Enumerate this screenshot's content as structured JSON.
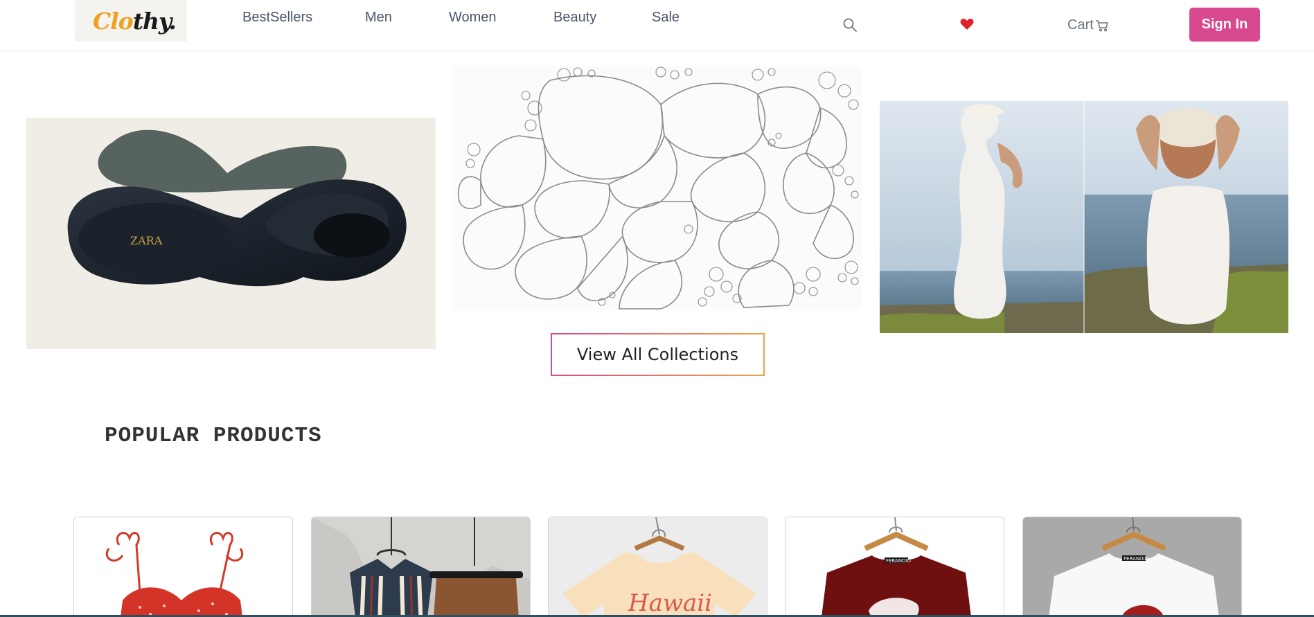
{
  "header": {
    "logo": {
      "part1": "Clo",
      "part2": "thy."
    },
    "nav": [
      {
        "label": "BestSellers",
        "id": "bestsellers"
      },
      {
        "label": "Men",
        "id": "men"
      },
      {
        "label": "Women",
        "id": "women"
      },
      {
        "label": "Beauty",
        "id": "beauty"
      },
      {
        "label": "Sale",
        "id": "sale"
      }
    ],
    "cart_label": "Cart",
    "signin_label": "Sign In",
    "icons": {
      "search": "search-icon",
      "wishlist": "heart-icon",
      "cart": "shopping-cart-icon"
    },
    "colors": {
      "brand": "#d9498f",
      "logo_accent": "#f0a020",
      "heart": "#e0202a"
    }
  },
  "hero": {
    "collections_button": "View All Collections",
    "images": [
      {
        "name": "black-heel-sandal",
        "brand_mark": "ZARA"
      },
      {
        "name": "bubble-line-art"
      },
      {
        "name": "white-lace-dress-model-beach"
      }
    ]
  },
  "popular": {
    "title": "POPULAR PRODUCTS",
    "products": [
      {
        "name": "red-floral-top"
      },
      {
        "name": "striped-shirt-shorts-set"
      },
      {
        "name": "hawaii-tshirt",
        "print": "Hawaii"
      },
      {
        "name": "maroon-graphic-tshirt",
        "tag": "FERANOID"
      },
      {
        "name": "white-graphic-tshirt",
        "tag": "FERANOID"
      }
    ]
  }
}
